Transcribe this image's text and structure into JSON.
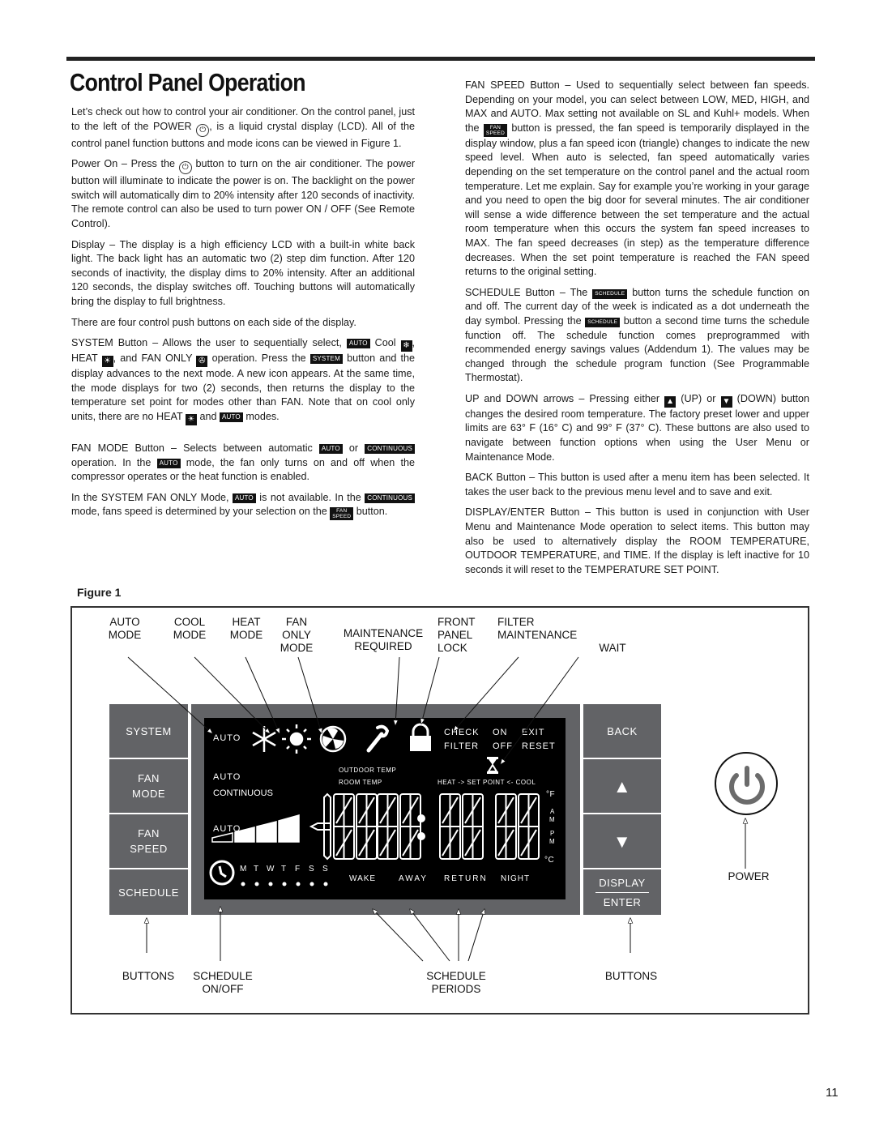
{
  "page": {
    "title": "Control Panel Operation",
    "page_number": "11",
    "figure_label": "Figure 1"
  },
  "left_column": {
    "intro_1": "Let’s check out how to control your air conditioner.  On the control panel, just to the left of the POWER",
    "intro_2": ", is a liquid crystal display (LCD).  All of the control panel function buttons and mode icons can be viewed in Figure 1.",
    "power_on_1": "Power On – Press the",
    "power_on_2": "button to turn on the air conditioner. The power button will illuminate to indicate the power is on. The backlight on the power switch will automatically dim to 20% intensity after 120 seconds of inactivity. The remote control can also be used to turn power ON / OFF (See Remote Control).",
    "display": "Display –  The display is a high efficiency LCD with a built-in white back light.  The back light has an automatic two (2) step dim function. After 120 seconds of inactivity, the display dims to 20% intensity.  After an additional 120 seconds, the display switches off.  Touching buttons will automatically bring the display to full brightness.",
    "four_buttons": "There are four control push buttons on each side of the display.",
    "system_1": "SYSTEM Button – Allows the user to sequentially select,",
    "system_2": "Cool",
    "system_3": ", HEAT",
    "system_4": ", and FAN ONLY",
    "system_5": "operation.  Press the",
    "system_6": "button and the display advances to the next mode.  A new icon appears.  At the same time, the mode displays for two (2) seconds, then returns the display to the temperature set point for modes other than FAN.  Note that on cool only units, there are no HEAT",
    "system_7": "and",
    "system_8": "modes.",
    "fan_mode_1": "FAN MODE Button – Selects between automatic",
    "fan_mode_2": "or",
    "fan_mode_3": "operation.  In the",
    "fan_mode_4": "mode, the fan only turns on and off when the compressor operates or the heat function is enabled.",
    "fan_only_1": "In the SYSTEM FAN ONLY Mode,",
    "fan_only_2": "is not available. In the",
    "fan_only_3": "mode, fans speed is determined by your selection on the",
    "fan_only_4": "button."
  },
  "right_column": {
    "fan_speed_1": "FAN SPEED Button – Used to sequentially select between fan speeds. Depending on your model, you can select between LOW, MED, HIGH, and MAX and AUTO.  Max setting not available on SL and Kuhl+ models. When the",
    "fan_speed_2": "button is pressed, the fan speed is temporarily displayed in the display window, plus a fan speed icon (triangle) changes to indicate the new speed level. When auto is selected, fan speed automatically varies depending on the set temperature on the control panel and the actual room temperature.  Let me explain.  Say for example you’re working in your garage and you need to open the big door for several minutes.  The air conditioner will sense a wide difference between the set temperature and the actual room temperature when this occurs the system fan speed increases to MAX.  The fan speed decreases (in step) as the temperature difference decreases.  When the set point temperature is reached the FAN speed returns to the original setting.",
    "schedule_1": "SCHEDULE Button – The",
    "schedule_2": "button turns the schedule function on and off.  The current day of the week is indicated as a dot underneath the day symbol.  Pressing the",
    "schedule_3": "button a second time turns the schedule function off.  The schedule function comes preprogrammed with recommended energy savings values (Addendum 1).  The values may be changed through the schedule program function (See Programmable Thermostat).",
    "updown_1": "UP and DOWN arrows – Pressing either",
    "updown_2": "(UP) or",
    "updown_3": "(DOWN) button changes the desired room temperature.  The factory preset lower and upper limits are 63° F (16° C) and 99° F (37° C).  These buttons are also used to navigate between function options when using the User Menu or Maintenance Mode.",
    "back": "BACK Button – This button is used after a menu item has been selected. It takes the user back to the previous menu level and to save and exit.",
    "display_enter": "DISPLAY/ENTER Button – This button is used in conjunction with User Menu and Maintenance Mode operation to select items. This button may also be used to alternatively display the ROOM TEMPERATURE, OUTDOOR TEMPERATURE, and TIME. If the display is left inactive for 10 seconds it will reset to the TEMPERATURE SET POINT."
  },
  "chips": {
    "auto": "AUTO",
    "system": "SYSTEM",
    "continuous": "CONTINUOUS",
    "fan": "FAN",
    "speed": "SPEED",
    "schedule": "SCHEDULE",
    "cool_icon": "❄",
    "heat_icon": "☀",
    "fan_icon": "✇",
    "power_icon": "⏻",
    "up_icon": "▲",
    "down_icon": "▼"
  },
  "figure": {
    "callouts_top": [
      {
        "line1": "",
        "line2": "AUTO",
        "line3": "MODE"
      },
      {
        "line1": "",
        "line2": "COOL",
        "line3": "MODE"
      },
      {
        "line1": "",
        "line2": "HEAT",
        "line3": "MODE"
      },
      {
        "line1": "FAN",
        "line2": "ONLY",
        "line3": "MODE"
      },
      {
        "line1": "MAINTENANCE",
        "line2": "REQUIRED",
        "line3": ""
      },
      {
        "line1": "FRONT",
        "line2": "PANEL",
        "line3": "LOCK"
      },
      {
        "line1": "",
        "line2": "FILTER",
        "line3": "MAINTENANCE"
      },
      {
        "line1": "",
        "line2": "",
        "line3": "WAIT"
      }
    ],
    "callouts_bottom": {
      "buttons_left": "BUTTONS",
      "schedule_onoff_1": "SCHEDULE",
      "schedule_onoff_2": "ON/OFF",
      "schedule_periods_1": "SCHEDULE",
      "schedule_periods_2": "PERIODS",
      "buttons_right": "BUTTONS",
      "power": "POWER"
    },
    "left_buttons": [
      {
        "line1": "SYSTEM",
        "line2": ""
      },
      {
        "line1": "FAN",
        "line2": "MODE"
      },
      {
        "line1": "FAN",
        "line2": "SPEED"
      },
      {
        "line1": "SCHEDULE",
        "line2": ""
      }
    ],
    "right_buttons": {
      "back": "BACK",
      "up": "▲",
      "down": "▼",
      "display": "DISPLAY",
      "enter": "ENTER"
    },
    "lcd": {
      "mode_auto": "AUTO",
      "fan_auto": "AUTO",
      "fan_continuous": "CONTINUOUS",
      "speed_auto": "AUTO",
      "check": "CHECK",
      "filter": "FILTER",
      "on": "ON",
      "off": "OFF",
      "exit": "EXIT",
      "reset": "RESET",
      "outdoor_temp": "OUTDOOR  TEMP",
      "room_temp": "ROOM TEMP",
      "setpoint": "HEAT -> SET POINT  <- COOL",
      "deg_f": "°F",
      "am_a": "A",
      "am_m": "M",
      "pm_p": "P",
      "pm_m": "M",
      "deg_c": "°C",
      "days": [
        "M",
        "T",
        "W",
        "T",
        "F",
        "S",
        "S"
      ],
      "periods": [
        "WAKE",
        "AWAY",
        "RETURN",
        "NIGHT"
      ],
      "segments": "188:88"
    }
  }
}
